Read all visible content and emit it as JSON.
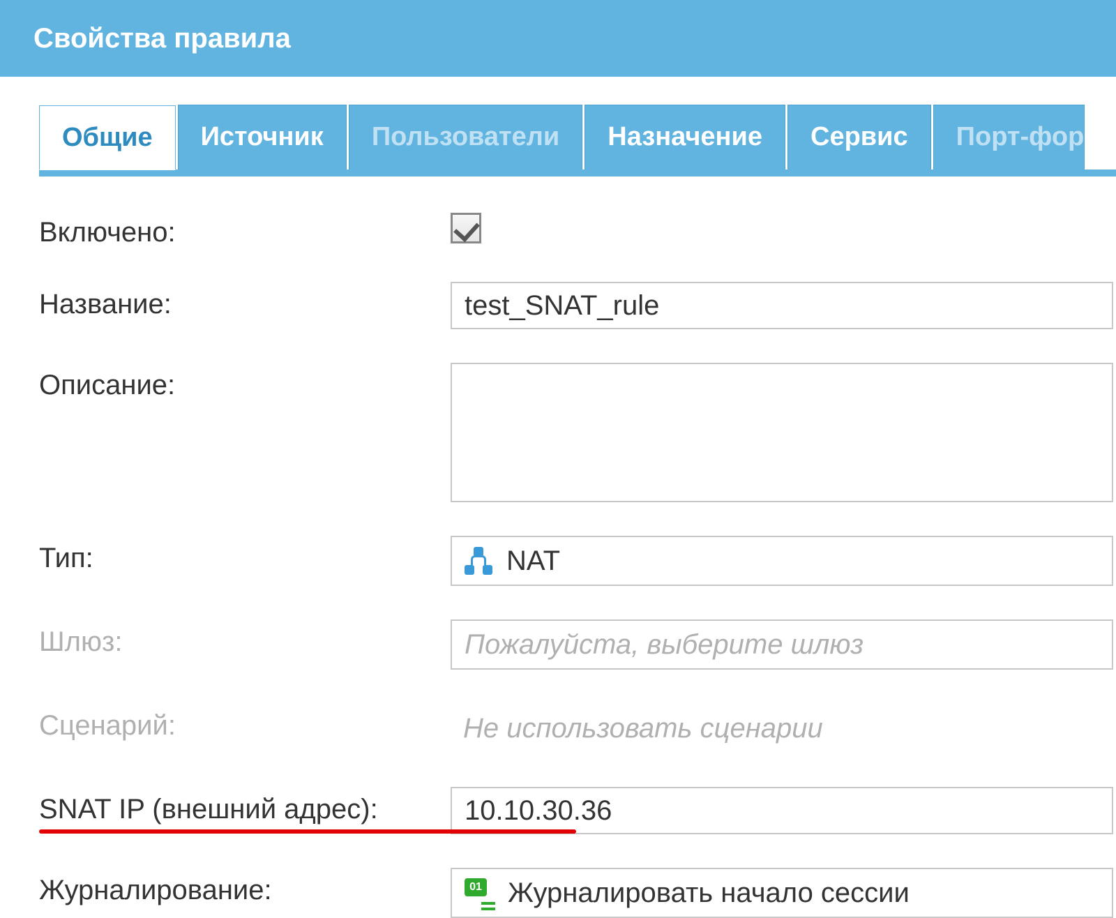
{
  "window": {
    "title": "Свойства правила"
  },
  "tabs": [
    {
      "label": "Общие",
      "state": "active"
    },
    {
      "label": "Источник",
      "state": "normal"
    },
    {
      "label": "Пользователи",
      "state": "disabled"
    },
    {
      "label": "Назначение",
      "state": "normal"
    },
    {
      "label": "Сервис",
      "state": "normal"
    },
    {
      "label": "Порт-фор",
      "state": "disabled-truncated"
    }
  ],
  "form": {
    "enabled": {
      "label": "Включено:",
      "checked": true
    },
    "name": {
      "label": "Название:",
      "value": "test_SNAT_rule"
    },
    "description": {
      "label": "Описание:",
      "value": ""
    },
    "type": {
      "label": "Тип:",
      "value": "NAT"
    },
    "gateway": {
      "label": "Шлюз:",
      "placeholder": "Пожалуйста, выберите шлюз",
      "disabled": true
    },
    "scenario": {
      "label": "Сценарий:",
      "placeholder": "Не использовать сценарии",
      "disabled": true
    },
    "snat_ip": {
      "label": "SNAT IP (внешний адрес):",
      "value": "10.10.30.36",
      "highlight": true
    },
    "logging": {
      "label": "Журналирование:",
      "value": "Журналировать начало сессии"
    }
  }
}
